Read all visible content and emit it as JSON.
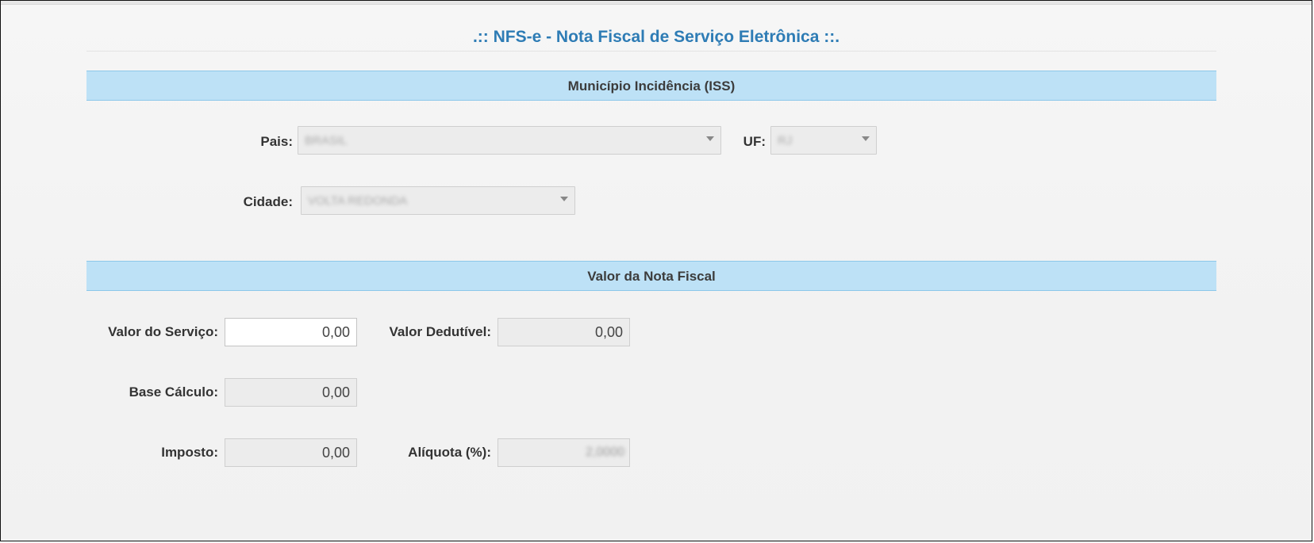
{
  "page": {
    "title": ".:: NFS-e - Nota Fiscal de Serviço Eletrônica ::."
  },
  "municipio": {
    "header": "Município Incidência (ISS)",
    "pais_label": "Pais:",
    "pais_value": "BRASIL",
    "uf_label": "UF:",
    "uf_value": "RJ",
    "cidade_label": "Cidade:",
    "cidade_value": "VOLTA REDONDA"
  },
  "valor": {
    "header": "Valor da Nota Fiscal",
    "servico_label": "Valor do Serviço:",
    "servico_value": "0,00",
    "dedutivel_label": "Valor Dedutível:",
    "dedutivel_value": "0,00",
    "base_label": "Base Cálculo:",
    "base_value": "0,00",
    "imposto_label": "Imposto:",
    "imposto_value": "0,00",
    "aliquota_label": "Alíquota (%):",
    "aliquota_value": "2,0000"
  },
  "colors": {
    "title": "#2e7cb5",
    "section_bg": "#bde1f6",
    "section_border": "#8cc7ea"
  }
}
